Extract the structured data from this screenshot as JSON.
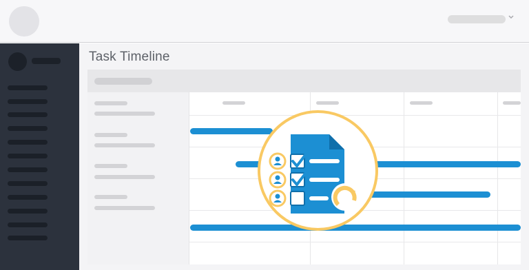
{
  "page": {
    "title": "Task Timeline"
  },
  "sidebar": {
    "item_count": 12
  },
  "timeline": {
    "rows": 4,
    "columns": 4
  },
  "icons": {
    "logo": "logo-placeholder-icon",
    "user_menu": "chevron-down-icon",
    "center_badge": "task-checklist-refresh-icon"
  },
  "colors": {
    "accent_bar": "#1c8fd3",
    "badge_ring": "#f9c963",
    "sidebar_bg": "#2c323d"
  }
}
